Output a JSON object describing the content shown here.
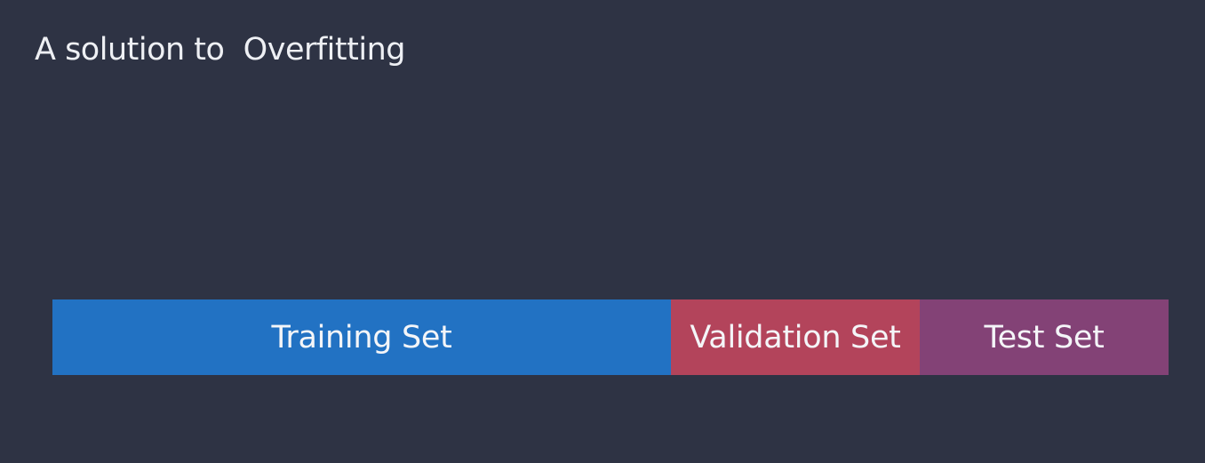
{
  "title": "A solution to  Overfitting",
  "split_bar": {
    "segments": [
      {
        "label": "Training Set",
        "color": "#2272c3"
      },
      {
        "label": "Validation Set",
        "color": "#b3445b"
      },
      {
        "label": "Test Set",
        "color": "#834276"
      }
    ]
  },
  "colors": {
    "background": "#2e3344",
    "text": "#eef0f4"
  }
}
